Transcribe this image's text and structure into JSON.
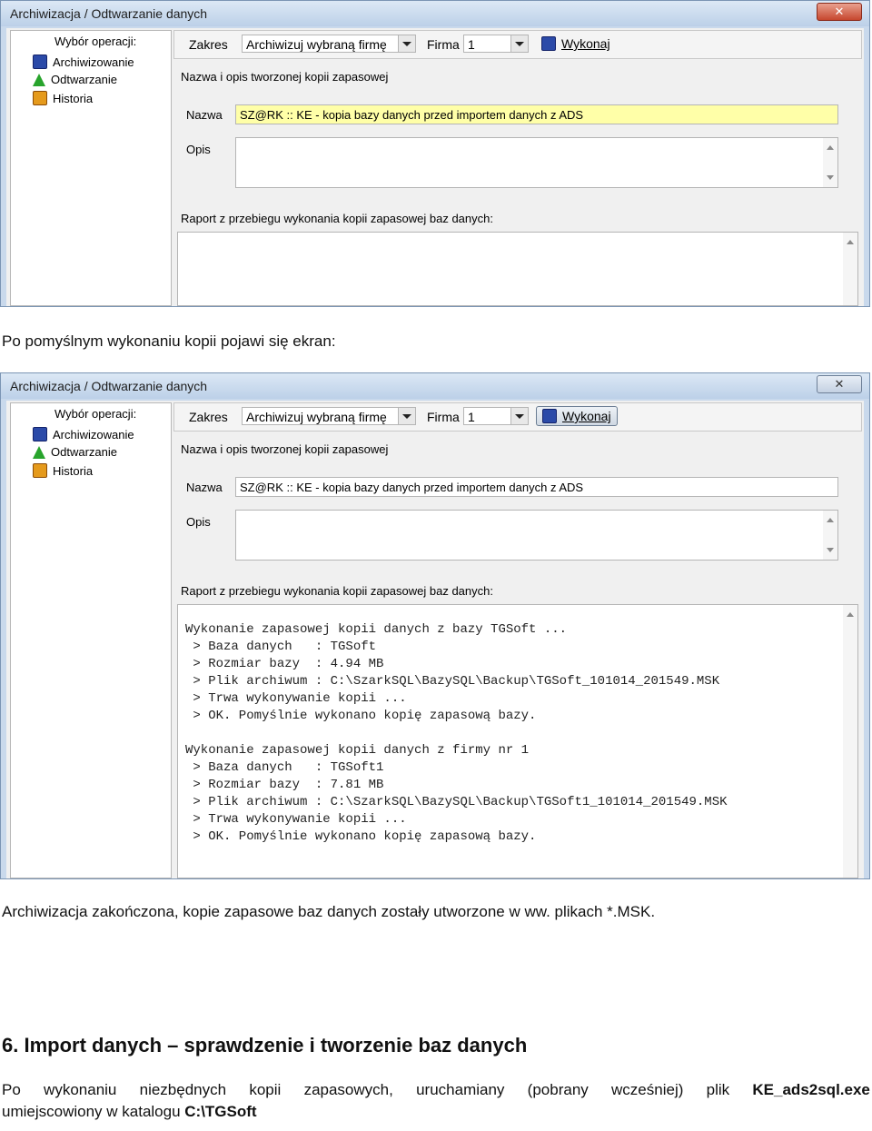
{
  "dialog": {
    "title": "Archiwizacja / Odtwarzanie danych",
    "close_glyph": "✕",
    "tree_header": "Wybór operacji:",
    "tree_items": [
      {
        "label": "Archiwizowanie",
        "icon": "disk-icon"
      },
      {
        "label": "Odtwarzanie",
        "icon": "green-arrow-icon"
      },
      {
        "label": "Historia",
        "icon": "history-icon"
      }
    ],
    "toolbar": {
      "zakres_label": "Zakres",
      "zakres_value": "Archiwizuj wybraną firmę",
      "firma_label": "Firma",
      "firma_value": "1",
      "run_label": "Wykonaj"
    },
    "backup_section_label": "Nazwa i opis tworzonej kopii zapasowej",
    "name_label": "Nazwa",
    "name_value": "SZ@RK :: KE - kopia bazy danych przed importem danych z ADS",
    "desc_label": "Opis",
    "desc_value": "",
    "report_label": "Raport z przebiegu wykonania kopii zapasowej baz danych:"
  },
  "report_lines": [
    "Wykonanie zapasowej kopii danych z bazy TGSoft ...",
    " > Baza danych   : TGSoft",
    " > Rozmiar bazy  : 4.94 MB",
    " > Plik archiwum : C:\\SzarkSQL\\BazySQL\\Backup\\TGSoft_101014_201549.MSK",
    " > Trwa wykonywanie kopii ...",
    " > OK. Pomyślnie wykonano kopię zapasową bazy.",
    "",
    "Wykonanie zapasowej kopii danych z firmy nr 1",
    " > Baza danych   : TGSoft1",
    " > Rozmiar bazy  : 7.81 MB",
    " > Plik archiwum : C:\\SzarkSQL\\BazySQL\\Backup\\TGSoft1_101014_201549.MSK",
    " > Trwa wykonywanie kopii ...",
    " > OK. Pomyślnie wykonano kopię zapasową bazy."
  ],
  "text": {
    "after_backup": "Po pomyślnym wykonaniu kopii pojawi się ekran:",
    "done": "Archiwizacja zakończona, kopie zapasowe baz danych zostały utworzone w ww. plikach *.MSK.",
    "heading": "6. Import danych – sprawdzenie i tworzenie baz danych",
    "p1_words": [
      "Po",
      "wykonaniu",
      "niezbędnych",
      "kopii",
      "zapasowych,",
      "uruchamiany",
      "(pobrany",
      "wcześniej)",
      "plik"
    ],
    "p1_bold": "KE_ads2sql.exe",
    "p1_line2": "umiejscowiony w katalogu ",
    "p1_bold2": "C:\\TGSoft"
  }
}
